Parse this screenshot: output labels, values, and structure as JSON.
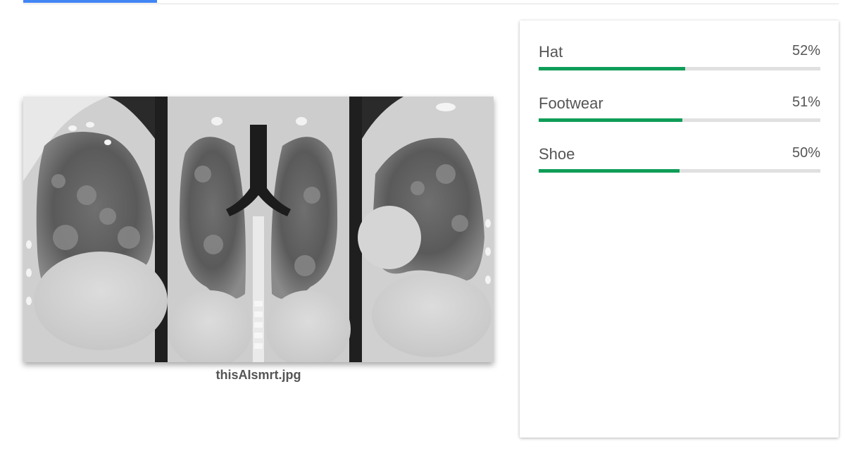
{
  "tabs": {
    "active_index": 0
  },
  "preview": {
    "filename": "thisAIsmrt.jpg",
    "icon": "ct-scan-image"
  },
  "results": {
    "accent_color": "#0f9d58",
    "labels": [
      {
        "name": "Hat",
        "score_text": "52%",
        "score": 0.52
      },
      {
        "name": "Footwear",
        "score_text": "51%",
        "score": 0.51
      },
      {
        "name": "Shoe",
        "score_text": "50%",
        "score": 0.5
      }
    ]
  }
}
